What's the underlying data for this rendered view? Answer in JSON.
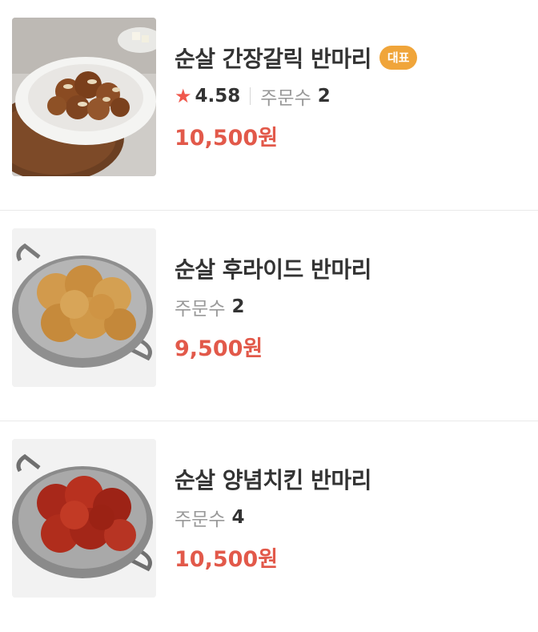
{
  "items": [
    {
      "name": "순살 간장갈릭 반마리",
      "badge": "대표",
      "rating": "4.58",
      "orders_label": "주문수",
      "orders_count": "2",
      "price": "10,500원"
    },
    {
      "name": "순살 후라이드 반마리",
      "orders_label": "주문수",
      "orders_count": "2",
      "price": "9,500원"
    },
    {
      "name": "순살 양념치킨 반마리",
      "orders_label": "주문수",
      "orders_count": "4",
      "price": "10,500원"
    }
  ],
  "colors": {
    "price": "#e2594a",
    "star": "#f0584c",
    "badge_bg": "#f0a53a"
  }
}
